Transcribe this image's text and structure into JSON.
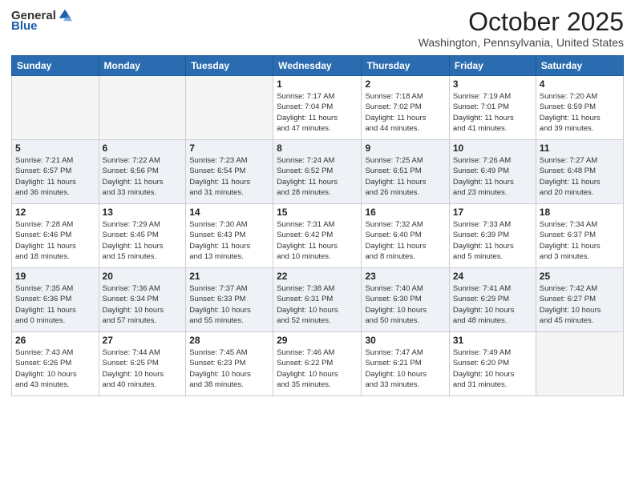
{
  "header": {
    "logo_general": "General",
    "logo_blue": "Blue",
    "month": "October 2025",
    "location": "Washington, Pennsylvania, United States"
  },
  "weekdays": [
    "Sunday",
    "Monday",
    "Tuesday",
    "Wednesday",
    "Thursday",
    "Friday",
    "Saturday"
  ],
  "weeks": [
    [
      {
        "day": "",
        "info": ""
      },
      {
        "day": "",
        "info": ""
      },
      {
        "day": "",
        "info": ""
      },
      {
        "day": "1",
        "info": "Sunrise: 7:17 AM\nSunset: 7:04 PM\nDaylight: 11 hours\nand 47 minutes."
      },
      {
        "day": "2",
        "info": "Sunrise: 7:18 AM\nSunset: 7:02 PM\nDaylight: 11 hours\nand 44 minutes."
      },
      {
        "day": "3",
        "info": "Sunrise: 7:19 AM\nSunset: 7:01 PM\nDaylight: 11 hours\nand 41 minutes."
      },
      {
        "day": "4",
        "info": "Sunrise: 7:20 AM\nSunset: 6:59 PM\nDaylight: 11 hours\nand 39 minutes."
      }
    ],
    [
      {
        "day": "5",
        "info": "Sunrise: 7:21 AM\nSunset: 6:57 PM\nDaylight: 11 hours\nand 36 minutes."
      },
      {
        "day": "6",
        "info": "Sunrise: 7:22 AM\nSunset: 6:56 PM\nDaylight: 11 hours\nand 33 minutes."
      },
      {
        "day": "7",
        "info": "Sunrise: 7:23 AM\nSunset: 6:54 PM\nDaylight: 11 hours\nand 31 minutes."
      },
      {
        "day": "8",
        "info": "Sunrise: 7:24 AM\nSunset: 6:52 PM\nDaylight: 11 hours\nand 28 minutes."
      },
      {
        "day": "9",
        "info": "Sunrise: 7:25 AM\nSunset: 6:51 PM\nDaylight: 11 hours\nand 26 minutes."
      },
      {
        "day": "10",
        "info": "Sunrise: 7:26 AM\nSunset: 6:49 PM\nDaylight: 11 hours\nand 23 minutes."
      },
      {
        "day": "11",
        "info": "Sunrise: 7:27 AM\nSunset: 6:48 PM\nDaylight: 11 hours\nand 20 minutes."
      }
    ],
    [
      {
        "day": "12",
        "info": "Sunrise: 7:28 AM\nSunset: 6:46 PM\nDaylight: 11 hours\nand 18 minutes."
      },
      {
        "day": "13",
        "info": "Sunrise: 7:29 AM\nSunset: 6:45 PM\nDaylight: 11 hours\nand 15 minutes."
      },
      {
        "day": "14",
        "info": "Sunrise: 7:30 AM\nSunset: 6:43 PM\nDaylight: 11 hours\nand 13 minutes."
      },
      {
        "day": "15",
        "info": "Sunrise: 7:31 AM\nSunset: 6:42 PM\nDaylight: 11 hours\nand 10 minutes."
      },
      {
        "day": "16",
        "info": "Sunrise: 7:32 AM\nSunset: 6:40 PM\nDaylight: 11 hours\nand 8 minutes."
      },
      {
        "day": "17",
        "info": "Sunrise: 7:33 AM\nSunset: 6:39 PM\nDaylight: 11 hours\nand 5 minutes."
      },
      {
        "day": "18",
        "info": "Sunrise: 7:34 AM\nSunset: 6:37 PM\nDaylight: 11 hours\nand 3 minutes."
      }
    ],
    [
      {
        "day": "19",
        "info": "Sunrise: 7:35 AM\nSunset: 6:36 PM\nDaylight: 11 hours\nand 0 minutes."
      },
      {
        "day": "20",
        "info": "Sunrise: 7:36 AM\nSunset: 6:34 PM\nDaylight: 10 hours\nand 57 minutes."
      },
      {
        "day": "21",
        "info": "Sunrise: 7:37 AM\nSunset: 6:33 PM\nDaylight: 10 hours\nand 55 minutes."
      },
      {
        "day": "22",
        "info": "Sunrise: 7:38 AM\nSunset: 6:31 PM\nDaylight: 10 hours\nand 52 minutes."
      },
      {
        "day": "23",
        "info": "Sunrise: 7:40 AM\nSunset: 6:30 PM\nDaylight: 10 hours\nand 50 minutes."
      },
      {
        "day": "24",
        "info": "Sunrise: 7:41 AM\nSunset: 6:29 PM\nDaylight: 10 hours\nand 48 minutes."
      },
      {
        "day": "25",
        "info": "Sunrise: 7:42 AM\nSunset: 6:27 PM\nDaylight: 10 hours\nand 45 minutes."
      }
    ],
    [
      {
        "day": "26",
        "info": "Sunrise: 7:43 AM\nSunset: 6:26 PM\nDaylight: 10 hours\nand 43 minutes."
      },
      {
        "day": "27",
        "info": "Sunrise: 7:44 AM\nSunset: 6:25 PM\nDaylight: 10 hours\nand 40 minutes."
      },
      {
        "day": "28",
        "info": "Sunrise: 7:45 AM\nSunset: 6:23 PM\nDaylight: 10 hours\nand 38 minutes."
      },
      {
        "day": "29",
        "info": "Sunrise: 7:46 AM\nSunset: 6:22 PM\nDaylight: 10 hours\nand 35 minutes."
      },
      {
        "day": "30",
        "info": "Sunrise: 7:47 AM\nSunset: 6:21 PM\nDaylight: 10 hours\nand 33 minutes."
      },
      {
        "day": "31",
        "info": "Sunrise: 7:49 AM\nSunset: 6:20 PM\nDaylight: 10 hours\nand 31 minutes."
      },
      {
        "day": "",
        "info": ""
      }
    ]
  ]
}
